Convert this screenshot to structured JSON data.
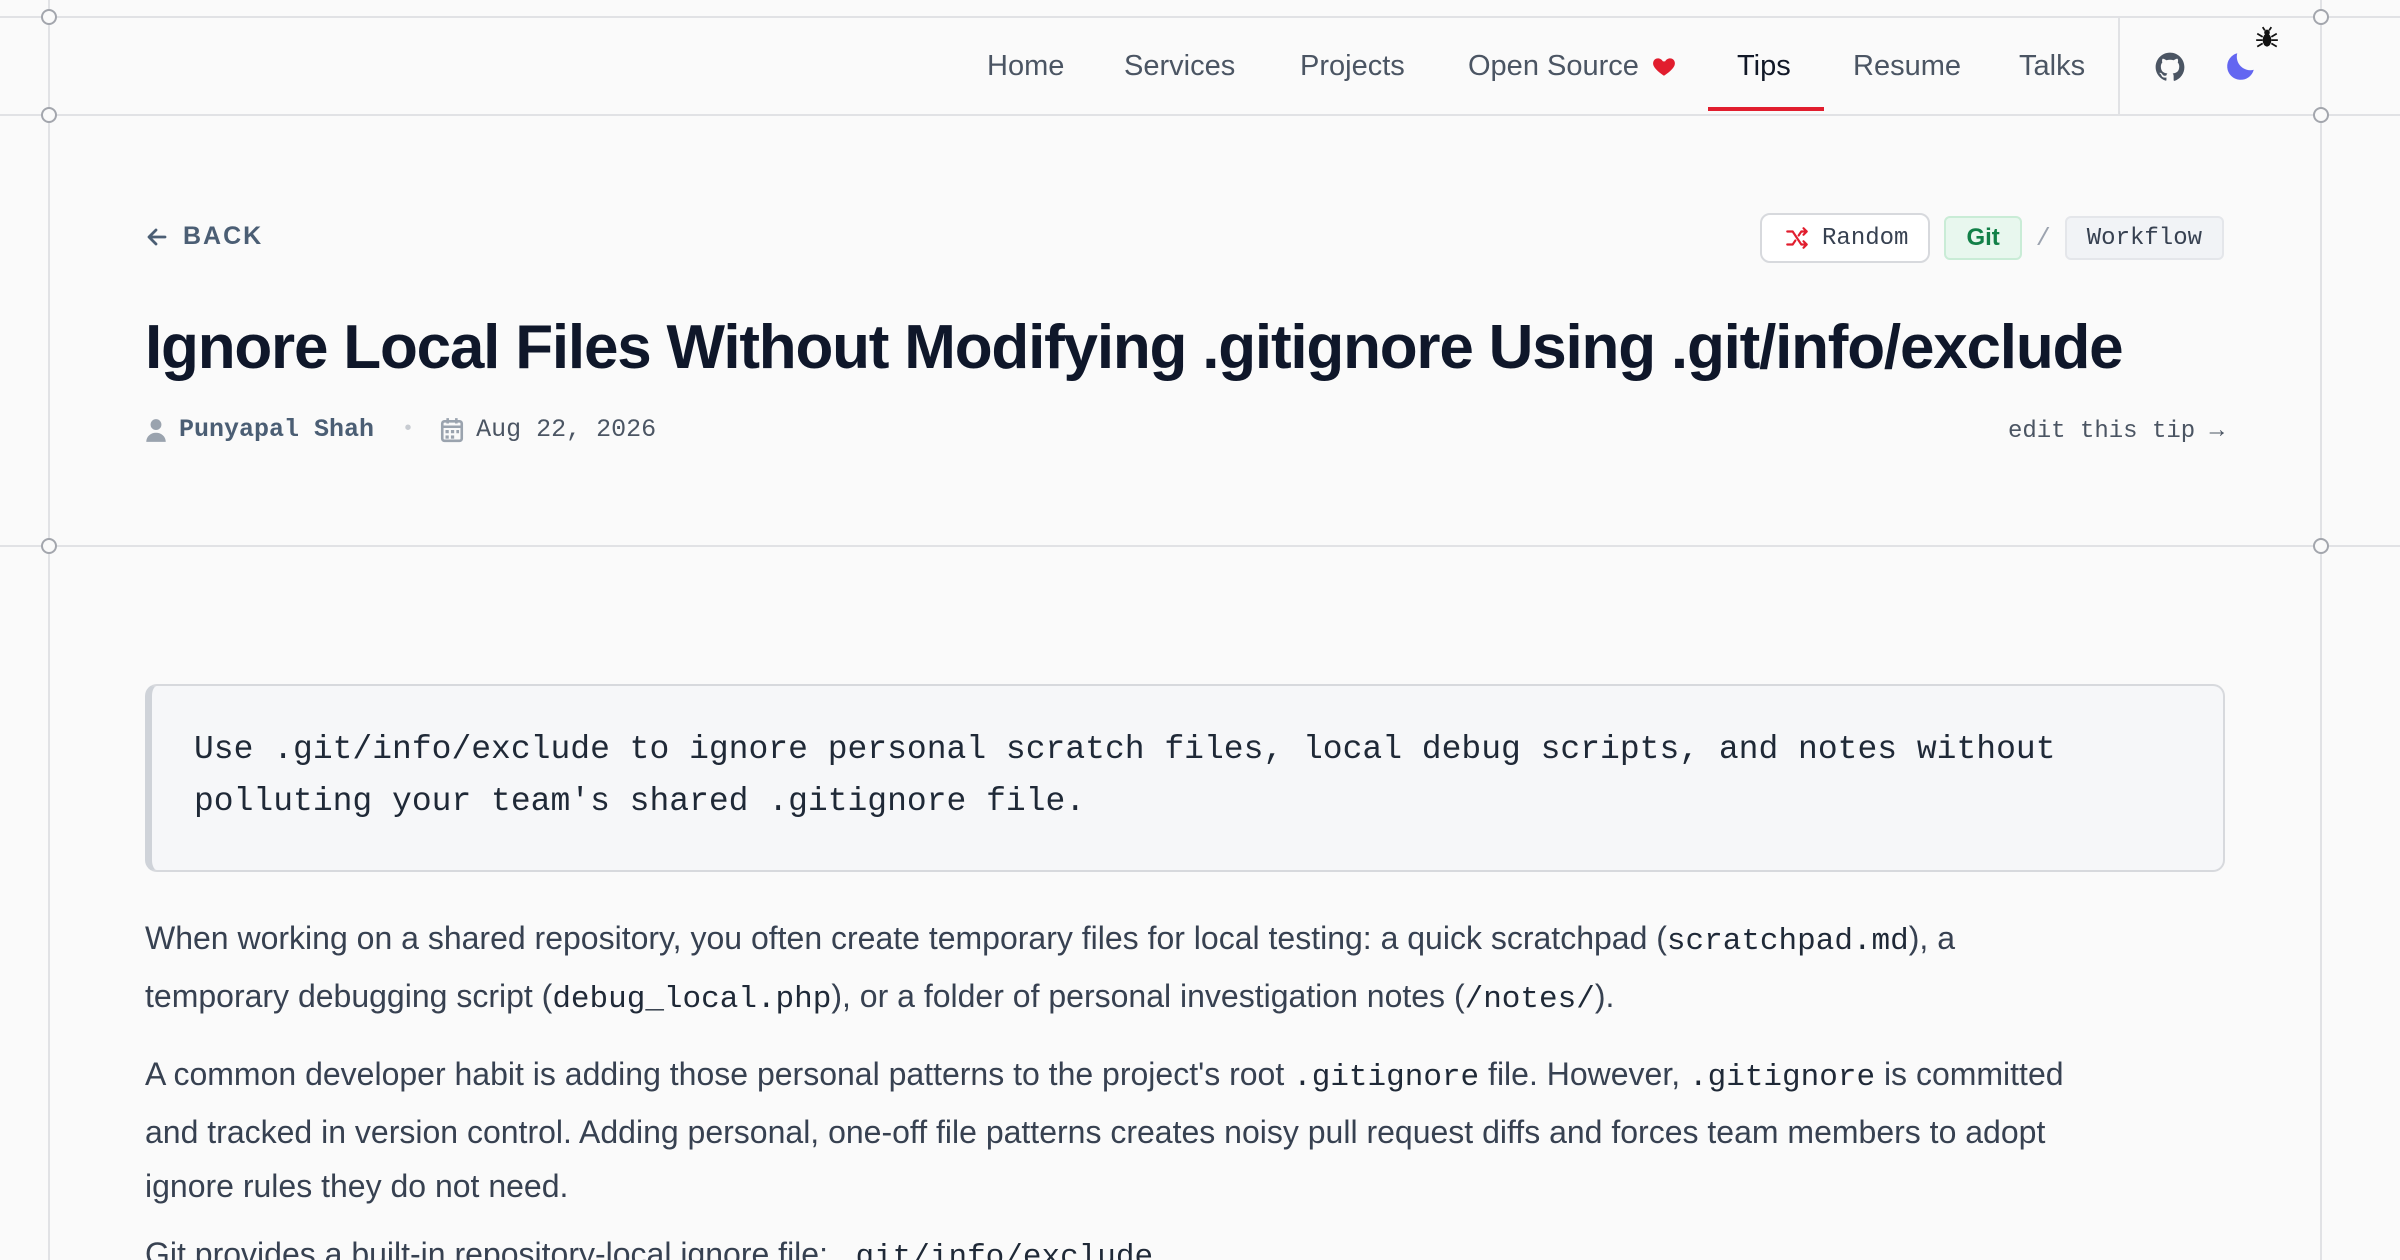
{
  "nav": {
    "items": [
      "Home",
      "Services",
      "Projects",
      "Open Source",
      "Tips",
      "Resume",
      "Talks"
    ],
    "active": "Tips"
  },
  "back_label": "BACK",
  "tags": {
    "random": "Random",
    "category": "Git",
    "separator": "/",
    "subcategory": "Workflow"
  },
  "article": {
    "title": "Ignore Local Files Without Modifying .gitignore Using .git/info/exclude",
    "author": "Punyapal Shah",
    "date": "Aug 22, 2026",
    "edit_label": "edit this tip →",
    "callout_line1": "Use .git/info/exclude to ignore personal scratch files, local debug scripts, and notes without",
    "callout_line2": "polluting your team's shared .gitignore file.",
    "p1": [
      "When working on a shared repository, you often create temporary files for local testing: a quick scratchpad (",
      "scratchpad.md",
      "), a",
      "temporary debugging script (",
      "debug_local.php",
      "), or a folder of personal investigation notes (",
      "/notes/",
      ")."
    ],
    "p2": [
      "A common developer habit is adding those personal patterns to the project's root ",
      ".gitignore",
      " file. However, ",
      ".gitignore",
      " is committed",
      "and tracked in version control. Adding personal, one-off file patterns creates noisy pull request diffs and forces team members to adopt",
      "ignore rules they do not need."
    ],
    "p3": [
      "Git provides a built-in repository-local ignore file: ",
      ".git/info/exclude",
      "."
    ]
  },
  "colors": {
    "accent": "#e11d2e",
    "git_tag": "#128048",
    "moon": "#6366f1",
    "background": "#fafafa"
  },
  "icons": [
    "heart-icon",
    "github-icon",
    "moon-icon",
    "bug-icon",
    "arrow-left-icon",
    "shuffle-icon",
    "user-icon",
    "calendar-icon"
  ]
}
